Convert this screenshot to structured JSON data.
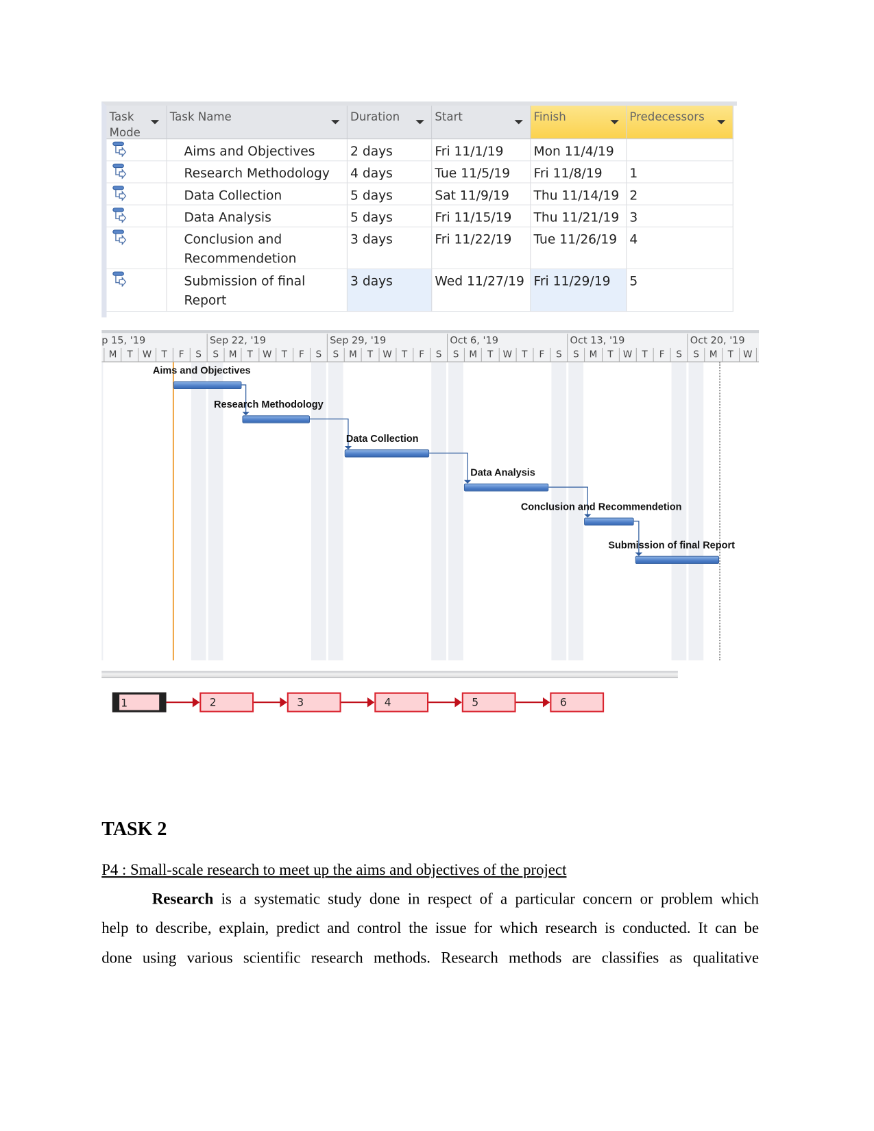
{
  "table": {
    "headers": [
      "Task Mode",
      "Task Name",
      "Duration",
      "Start",
      "Finish",
      "Predecessors"
    ],
    "rows": [
      {
        "mode_icon": "auto-scheduled-task-icon",
        "name": "Aims and Objectives",
        "duration": "2 days",
        "start": "Fri 11/1/19",
        "finish": "Mon 11/4/19",
        "pred": ""
      },
      {
        "mode_icon": "auto-scheduled-task-icon",
        "name": "Research Methodology",
        "duration": "4 days",
        "start": "Tue 11/5/19",
        "finish": "Fri 11/8/19",
        "pred": "1"
      },
      {
        "mode_icon": "auto-scheduled-task-icon",
        "name": "Data Collection",
        "duration": "5 days",
        "start": "Sat 11/9/19",
        "finish": "Thu 11/14/19",
        "pred": "2"
      },
      {
        "mode_icon": "auto-scheduled-task-icon",
        "name": "Data Analysis",
        "duration": "5 days",
        "start": "Fri 11/15/19",
        "finish": "Thu 11/21/19",
        "pred": "3"
      },
      {
        "mode_icon": "auto-scheduled-task-icon",
        "name": "Conclusion and Recommendetion",
        "duration": "3 days",
        "start": "Fri 11/22/19",
        "finish": "Tue 11/26/19",
        "pred": "4"
      },
      {
        "mode_icon": "auto-scheduled-task-icon",
        "name": "Submission of final Report",
        "duration": "3 days",
        "start": "Wed 11/27/19",
        "finish": "Fri 11/29/19",
        "pred": "5"
      }
    ],
    "highlight_color": "#fbd24e"
  },
  "gantt": {
    "weeks": [
      "p 15, '19",
      "Sep 22, '19",
      "Sep 29, '19",
      "Oct 6, '19",
      "Oct 13, '19",
      "Oct 20, '19"
    ],
    "day_letters": [
      "S",
      "M",
      "T",
      "W",
      "T",
      "F",
      "S"
    ],
    "bar_labels": [
      "Aims and Objectives",
      "Research Methodology",
      "Data Collection",
      "Data Analysis",
      "Conclusion and Recommendetion",
      "Submission of final Report"
    ],
    "bar_color": "#4e7fc8"
  },
  "network": {
    "nodes": [
      "1",
      "2",
      "3",
      "4",
      "5",
      "6"
    ],
    "node_color": "#fdd3d6",
    "link_color": "#c0101b"
  },
  "document": {
    "heading": "TASK 2",
    "subheading": "P4 : Small-scale research to meet up the aims and objectives of the project",
    "para_bold": "Research",
    "para_line1": " is a systematic study  done in respect of a particular concern or problem which",
    "para_line2": "help to describe, explain, predict and control the issue for which research is conducted. It can be",
    "para_line3": "done using various scientific research methods. Research methods are classifies as qualitative"
  }
}
